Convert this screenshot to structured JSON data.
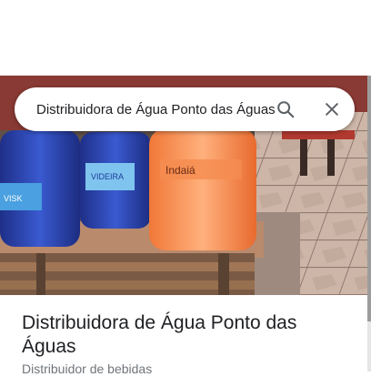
{
  "search": {
    "query": "Distribuidora de Água Ponto das Águas",
    "search_icon": "search-icon",
    "clear_icon": "close-icon"
  },
  "place": {
    "name": "Distribuidora de Água Ponto das Águas",
    "category": "Distribuidor de bebidas",
    "photo_bottle_label": "Indaiá",
    "photo_bottle_label_2": "VIDEIRA"
  },
  "colors": {
    "accent_text": "#202124",
    "secondary_text": "#70757a",
    "icon": "#5f6368"
  }
}
